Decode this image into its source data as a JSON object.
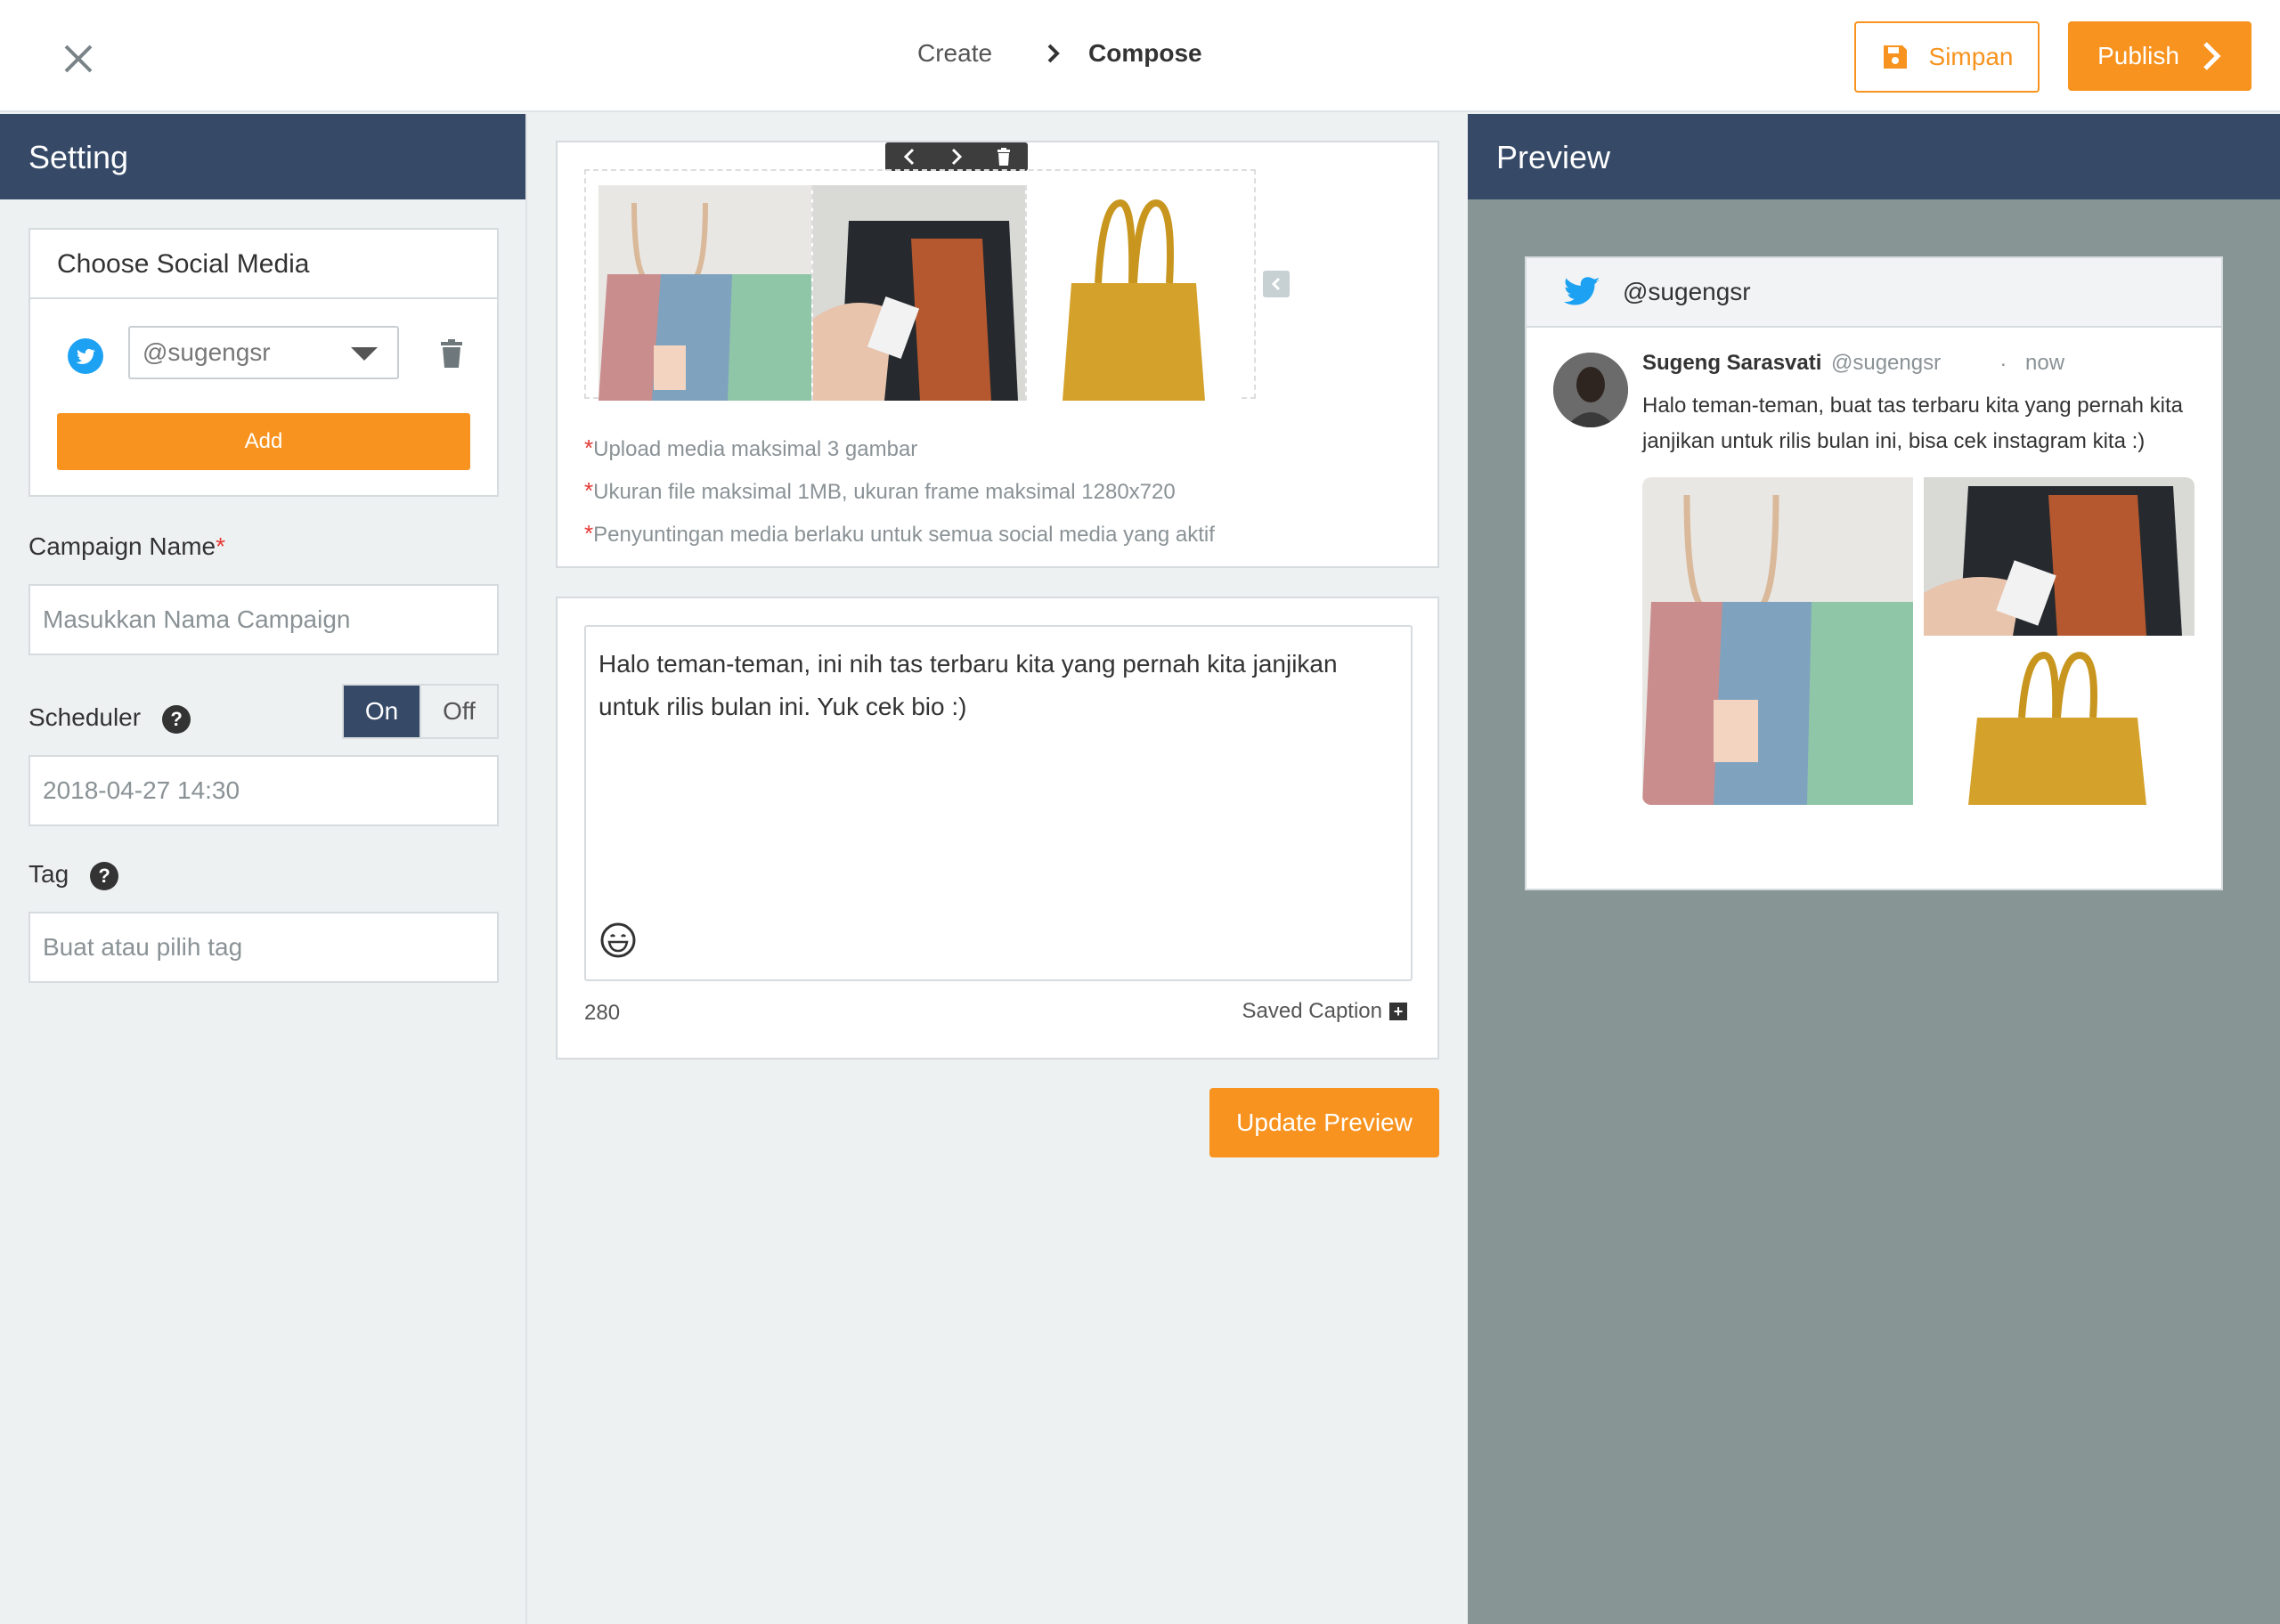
{
  "header": {
    "breadcrumb": [
      "Create",
      "Compose"
    ],
    "save_label": "Simpan",
    "publish_label": "Publish"
  },
  "left": {
    "title": "Setting",
    "social_card_title": "Choose Social Media",
    "account": "@sugengsr",
    "add_label": "Add",
    "campaign_label": "Campaign Name",
    "campaign_required": "*",
    "campaign_placeholder": "Masukkan Nama Campaign",
    "scheduler_label": "Scheduler",
    "help_glyph": "?",
    "toggle_on": "On",
    "toggle_off": "Off",
    "scheduler_value": "2018-04-27  14:30",
    "tag_label": "Tag",
    "tag_placeholder": "Buat atau pilih tag"
  },
  "media": {
    "required": "*",
    "notes": [
      "Upload media maksimal 3 gambar",
      "Ukuran file maksimal 1MB, ukuran frame maksimal 1280x720",
      "Penyuntingan media berlaku untuk semua social media yang aktif"
    ]
  },
  "caption": {
    "text": "Halo teman-teman, ini nih tas terbaru kita yang pernah kita janjikan untuk rilis bulan ini. Yuk cek bio :)",
    "char_count": "280",
    "saved_caption_label": "Saved Caption",
    "update_label": "Update Preview"
  },
  "preview": {
    "title": "Preview",
    "account": "@sugengsr",
    "name": "Sugeng Sarasvati",
    "handle": "@sugengsr",
    "dot": ".",
    "time": "now",
    "text": "Halo teman-teman, buat tas terbaru kita yang pernah kita janjikan untuk rilis bulan ini, bisa cek instagram kita :)"
  },
  "colors": {
    "accent": "#f7931e",
    "navy": "#364a68",
    "twitter": "#1da1f2",
    "preview_bg": "#879595"
  }
}
